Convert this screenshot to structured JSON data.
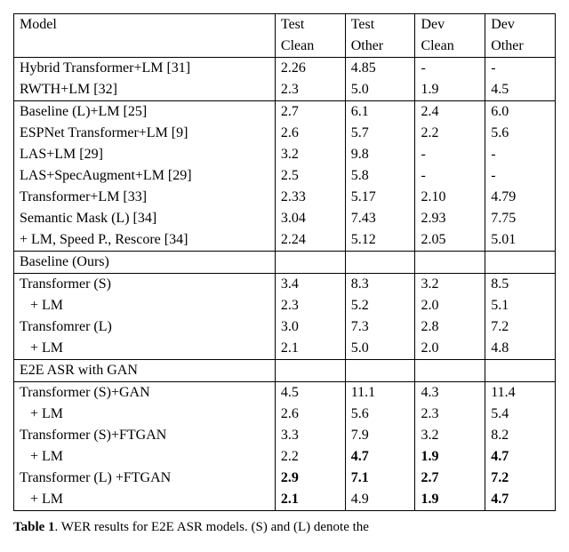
{
  "header": {
    "c0": "Model",
    "c1a": "Test",
    "c1b": "Clean",
    "c2a": "Test",
    "c2b": "Other",
    "c3a": "Dev",
    "c3b": "Clean",
    "c4a": "Dev",
    "c4b": "Other"
  },
  "sec1": {
    "r0": {
      "m": "Hybrid Transformer+LM [31]",
      "v": [
        "2.26",
        "4.85",
        "-",
        "-"
      ]
    },
    "r1": {
      "m": "RWTH+LM [32]",
      "v": [
        "2.3",
        "5.0",
        "1.9",
        "4.5"
      ]
    }
  },
  "sec2": {
    "r0": {
      "m": "Baseline (L)+LM  [25]",
      "v": [
        "2.7",
        "6.1",
        "2.4",
        "6.0"
      ]
    },
    "r1": {
      "m": "ESPNet Transformer+LM  [9]",
      "v": [
        "2.6",
        "5.7",
        "2.2",
        "5.6"
      ]
    },
    "r2": {
      "m": "LAS+LM [29]",
      "v": [
        "3.2",
        "9.8",
        "-",
        "-"
      ]
    },
    "r3": {
      "m": "LAS+SpecAugment+LM [29]",
      "v": [
        "2.5",
        "5.8",
        "-",
        "-"
      ]
    },
    "r4": {
      "m": "Transformer+LM [33]",
      "v": [
        "2.33",
        "5.17",
        "2.10",
        "4.79"
      ]
    },
    "r5": {
      "m": "Semantic Mask (L)  [34]",
      "v": [
        "3.04",
        "7.43",
        "2.93",
        "7.75"
      ]
    },
    "r6": {
      "m": "  + LM, Speed P., Rescore [34]",
      "v": [
        "2.24",
        "5.12",
        "2.05",
        "5.01"
      ]
    }
  },
  "sec3hdr": "Baseline (Ours)",
  "sec3": {
    "r0": {
      "m": "Transformer (S)",
      "v": [
        "3.4",
        "8.3",
        "3.2",
        "8.5"
      ]
    },
    "r1": {
      "m": "      + LM",
      "v": [
        "2.3",
        "5.2",
        "2.0",
        "5.1"
      ]
    },
    "r2": {
      "m": "Transfomrer (L)",
      "v": [
        "3.0",
        "7.3",
        "2.8",
        "7.2"
      ]
    },
    "r3": {
      "m": "      + LM",
      "v": [
        "2.1",
        "5.0",
        "2.0",
        "4.8"
      ]
    }
  },
  "sec4hdr": "E2E ASR with GAN",
  "sec4": {
    "r0": {
      "m": "Transformer (S)+GAN",
      "v": [
        "4.5",
        "11.1",
        "4.3",
        "11.4"
      ],
      "b": [
        0,
        0,
        0,
        0
      ]
    },
    "r1": {
      "m": "      + LM",
      "v": [
        "2.6",
        "5.6",
        "2.3",
        "5.4"
      ],
      "b": [
        0,
        0,
        0,
        0
      ]
    },
    "r2": {
      "m": "Transformer (S)+FTGAN",
      "v": [
        "3.3",
        "7.9",
        "3.2",
        "8.2"
      ],
      "b": [
        0,
        0,
        0,
        0
      ]
    },
    "r3": {
      "m": "      + LM",
      "v": [
        "2.2",
        "4.7",
        "1.9",
        "4.7"
      ],
      "b": [
        0,
        1,
        1,
        1
      ]
    },
    "r4": {
      "m": "Transformer (L) +FTGAN",
      "v": [
        "2.9",
        "7.1",
        "2.7",
        "7.2"
      ],
      "b": [
        1,
        1,
        1,
        1
      ]
    },
    "r5": {
      "m": "      + LM",
      "v": [
        "2.1",
        "4.9",
        "1.9",
        "4.7"
      ],
      "b": [
        1,
        0,
        1,
        1
      ]
    }
  },
  "caption": {
    "label": "Table 1",
    "text_partial": ". WER results for E2E ASR models. (S) and (L) denote the"
  },
  "chart_data": {
    "type": "table",
    "columns": [
      "Model",
      "Test Clean",
      "Test Other",
      "Dev Clean",
      "Dev Other"
    ],
    "sections": [
      {
        "rows": [
          [
            "Hybrid Transformer+LM [31]",
            "2.26",
            "4.85",
            "-",
            "-"
          ],
          [
            "RWTH+LM [32]",
            "2.3",
            "5.0",
            "1.9",
            "4.5"
          ]
        ]
      },
      {
        "rows": [
          [
            "Baseline (L)+LM [25]",
            "2.7",
            "6.1",
            "2.4",
            "6.0"
          ],
          [
            "ESPNet Transformer+LM [9]",
            "2.6",
            "5.7",
            "2.2",
            "5.6"
          ],
          [
            "LAS+LM [29]",
            "3.2",
            "9.8",
            "-",
            "-"
          ],
          [
            "LAS+SpecAugment+LM [29]",
            "2.5",
            "5.8",
            "-",
            "-"
          ],
          [
            "Transformer+LM [33]",
            "2.33",
            "5.17",
            "2.10",
            "4.79"
          ],
          [
            "Semantic Mask (L) [34]",
            "3.04",
            "7.43",
            "2.93",
            "7.75"
          ],
          [
            "+ LM, Speed P., Rescore [34]",
            "2.24",
            "5.12",
            "2.05",
            "5.01"
          ]
        ]
      },
      {
        "header": "Baseline (Ours)",
        "rows": [
          [
            "Transformer (S)",
            "3.4",
            "8.3",
            "3.2",
            "8.5"
          ],
          [
            "+ LM",
            "2.3",
            "5.2",
            "2.0",
            "5.1"
          ],
          [
            "Transfomrer (L)",
            "3.0",
            "7.3",
            "2.8",
            "7.2"
          ],
          [
            "+ LM",
            "2.1",
            "5.0",
            "2.0",
            "4.8"
          ]
        ]
      },
      {
        "header": "E2E ASR with GAN",
        "rows": [
          [
            "Transformer (S)+GAN",
            "4.5",
            "11.1",
            "4.3",
            "11.4"
          ],
          [
            "+ LM",
            "2.6",
            "5.6",
            "2.3",
            "5.4"
          ],
          [
            "Transformer (S)+FTGAN",
            "3.3",
            "7.9",
            "3.2",
            "8.2"
          ],
          [
            "+ LM",
            "2.2",
            "4.7",
            "1.9",
            "4.7"
          ],
          [
            "Transformer (L) +FTGAN",
            "2.9",
            "7.1",
            "2.7",
            "7.2"
          ],
          [
            "+ LM",
            "2.1",
            "4.9",
            "1.9",
            "4.7"
          ]
        ]
      }
    ]
  }
}
